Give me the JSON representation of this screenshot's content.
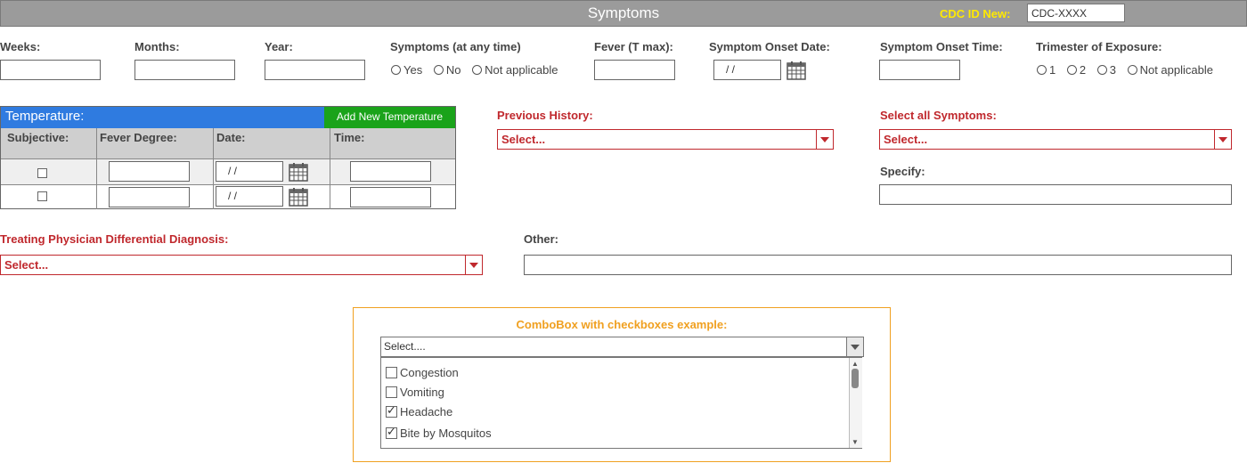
{
  "header": {
    "title": "Symptoms",
    "cdc_label": "CDC ID New:",
    "cdc_value": "CDC-XXXX"
  },
  "fields": {
    "weeks": "Weeks:",
    "months": "Months:",
    "year": "Year:",
    "symptoms_any": "Symptoms (at any time)",
    "symptoms_options": [
      "Yes",
      "No",
      "Not applicable"
    ],
    "fever_tmax": "Fever (T max):",
    "onset_date": "Symptom Onset Date:",
    "onset_date_value": "/  /",
    "onset_time": "Symptom Onset Time:",
    "trimester": "Trimester of Exposure:",
    "trimester_options": [
      "1",
      "2",
      "3",
      "Not applicable"
    ]
  },
  "temperature": {
    "title": "Temperature:",
    "add_button": "Add New Temperature",
    "columns": [
      "Subjective:",
      "Fever Degree:",
      "Date:",
      "Time:"
    ],
    "rows": [
      {
        "date": "/  /"
      },
      {
        "date": "/  /"
      }
    ]
  },
  "previous_history": {
    "label": "Previous History:",
    "value": "Select..."
  },
  "symptoms_select": {
    "label": "Select all Symptoms:",
    "value": "Select...",
    "specify": "Specify:"
  },
  "diagnosis": {
    "label": "Treating Physician Differential Diagnosis:",
    "value": "Select..."
  },
  "other": {
    "label": "Other:"
  },
  "combo": {
    "title": "ComboBox with checkboxes example:",
    "value": "Select....",
    "items": [
      {
        "label": "Congestion",
        "checked": false
      },
      {
        "label": "Vomiting",
        "checked": false
      },
      {
        "label": "Headache",
        "checked": true
      },
      {
        "label": "Bite by Mosquitos",
        "checked": true
      }
    ]
  },
  "colors": {
    "header": "#9b9b9b",
    "cdc_label": "#ffea00",
    "temp_header": "#2f7be0",
    "add_button": "#1aa31a",
    "required": "#c0282d",
    "combo_accent": "#f0a020"
  },
  "icons": [
    "calendar-icon",
    "dropdown-arrow-icon",
    "checkbox-icon",
    "radio-icon"
  ]
}
